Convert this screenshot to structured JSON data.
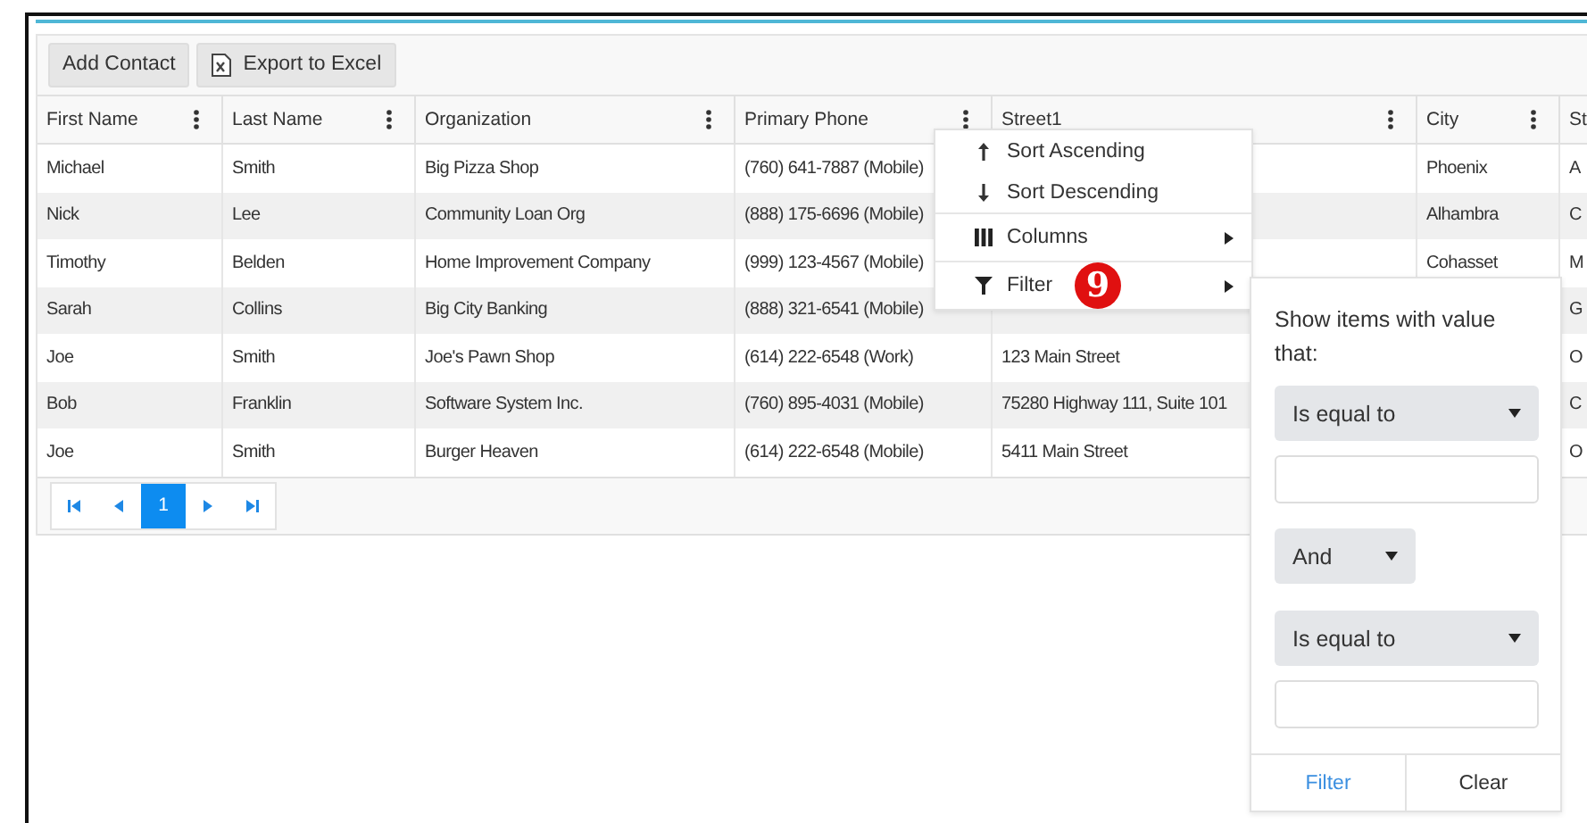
{
  "toolbar": [
    {
      "label": "Add Contact",
      "kind": "plain"
    },
    {
      "label": "Export to Excel",
      "kind": "excel"
    }
  ],
  "columns": [
    "First Name",
    "Last Name",
    "Organization",
    "Primary Phone",
    "Street1",
    "City",
    "St"
  ],
  "rows": [
    {
      "first_name": "Michael",
      "last_name": "Smith",
      "organization": "Big Pizza Shop",
      "primary_phone": "(760) 641-7887 (Mobile)",
      "city": "Phoenix",
      "column_7": "A"
    },
    {
      "first_name": "Nick",
      "last_name": "Lee",
      "organization": "Community Loan Org",
      "primary_phone": "(888) 175-6696 (Mobile)",
      "city": "Alhambra",
      "column_7": "C"
    },
    {
      "first_name": "Timothy",
      "last_name": "Belden",
      "organization": "Home Improvement Company",
      "primary_phone": "(999) 123-4567 (Mobile)",
      "city": "Cohasset",
      "column_7": "M"
    },
    {
      "first_name": "Sarah",
      "last_name": "Collins",
      "organization": "Big City Banking",
      "primary_phone": "(888) 321-6541 (Mobile)",
      "column_7": "G"
    },
    {
      "first_name": "Joe",
      "last_name": "Smith",
      "organization": "Joe's Pawn Shop",
      "primary_phone": "(614) 222-6548 (Work)",
      "street1": "123 Main Street",
      "column_7": "O"
    },
    {
      "first_name": "Bob",
      "last_name": "Franklin",
      "organization": "Software System Inc.",
      "primary_phone": "(760) 895-4031 (Mobile)",
      "street1": "75280 Highway 111, Suite 101",
      "column_7": "C"
    },
    {
      "first_name": "Joe",
      "last_name": "Smith",
      "organization": "Burger Heaven",
      "primary_phone": "(614) 222-6548 (Mobile)",
      "street1": "5411 Main Street",
      "column_7": "O"
    }
  ],
  "pager": {
    "pages": [
      {
        "label": "1",
        "selected": true
      }
    ]
  },
  "column_menu": {
    "items": [
      {
        "label": "Sort Ascending",
        "kind": "sort-asc",
        "submenu": false
      },
      {
        "label": "Sort Descending",
        "kind": "sort-desc",
        "submenu": false
      },
      {
        "label": "Columns",
        "kind": "columns",
        "submenu": true
      },
      {
        "label": "Filter",
        "kind": "filter",
        "submenu": true
      }
    ],
    "badge": "9"
  },
  "filter_panel": {
    "prompt": "Show items with value that:",
    "operator_1": "Is equal to",
    "logic": "And",
    "operator_2": "Is equal to",
    "buttons": [
      {
        "label": "Filter",
        "primary": true
      },
      {
        "label": "Clear",
        "primary": false
      }
    ]
  }
}
